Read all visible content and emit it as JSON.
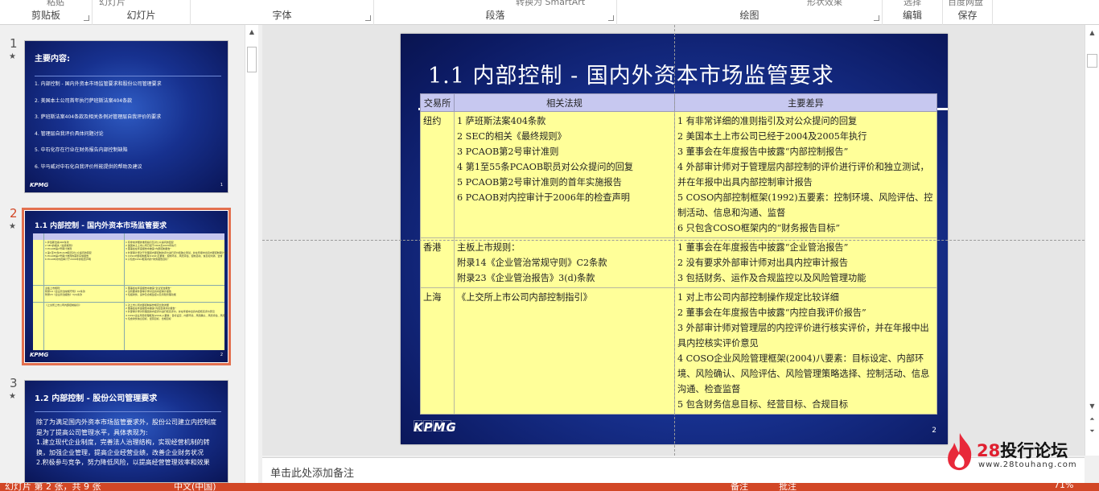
{
  "ribbon": {
    "groups": [
      {
        "label": "剪贴板",
        "cut_text": "粘贴"
      },
      {
        "label": "幻灯片",
        "cut_text": "幻灯片"
      },
      {
        "label": "字体",
        "cut_text": ""
      },
      {
        "label": "段落",
        "cut_text": "转换为 SmartArt"
      },
      {
        "label": "绘图",
        "cut_text": "形状效果"
      },
      {
        "label": "编辑",
        "cut_text": "选择"
      },
      {
        "label": "保存",
        "cut_text": "百度网盘"
      }
    ]
  },
  "thumbnails": [
    {
      "num": "1",
      "title": "主要内容:",
      "items": [
        "1. 内部控制 - 国内外资本市场监管要求和股份公司管理要求",
        "2. 美国本土公司首年执行萨班斯法案404条款",
        "3. 萨班斯法案404条款及相关条例对管理层自我评价的要求",
        "4. 管理层自我评价具体问题讨论",
        "5. 中石化存在行业在财务报告内部控制缺陷",
        "6. 毕马威对中石化自我评价所能提供的帮助及建议"
      ],
      "logo": "KPMG",
      "page": "1"
    },
    {
      "num": "2",
      "title": "1.1 内部控制 - 国内外资本市场监管要求",
      "logo": "KPMG",
      "page": "2"
    },
    {
      "num": "3",
      "title": "1.2 内部控制 - 股份公司管理要求",
      "body": "除了为满足国内外资本市场监管要求外，股份公司建立内控制度是为了提高公司管理水平，具体表现为:\n1.建立现代企业制度，完善法人治理结构，实现经营机制的转换，加强企业管理，提高企业经营业绩，改善企业财务状况\n2.积极参与竞争，努力降低风险，以提高经营管理效率和效果"
    }
  ],
  "slide": {
    "title": "1.1 内部控制 - 国内外资本市场监管要求",
    "headers": [
      "交易所",
      "相关法规",
      "主要差异"
    ],
    "rows": [
      {
        "exchange": "纽约",
        "laws": "1 萨班斯法案404条款\n2 SEC的相关《最终规则》\n3 PCAOB第2号审计准则\n4 第1至55条PCAOB职员对公众提问的回复\n5 PCAOB第2号审计准则的首年实施报告\n6 PCAOB对内控审计于2006年的检查声明",
        "diffs": "1 有非常详细的准则指引及对公众提问的回复\n2 美国本土上市公司已经于2004及2005年执行\n3 董事会在年度报告中披露“内部控制报告”\n4 外部审计师对于管理层内部控制的评价进行评价和独立测试，并在年报中出具内部控制审计报告\n5 COSO内部控制框架(1992)五要素：控制环境、风险评估、控制活动、信息和沟通、监督\n6 只包含COSO框架内的“财务报告目标”"
      },
      {
        "exchange": "香港",
        "laws": "主板上市规则：\n附录14《企业管治常规守则》C2条款\n附录23《企业管治报告》3(d)条款",
        "diffs": "1 董事会在年度报告中披露“企业管治报告”\n2 没有要求外部审计师对出具内控审计报告\n3 包括财务、运作及合规监控以及风险管理功能"
      },
      {
        "exchange": "上海",
        "laws": "《上交所上市公司内部控制指引》",
        "diffs": "1 对上市公司内部控制操作规定比较详细\n2 董事会在年度报告中披露“内控自我评价报告”\n3 外部审计师对管理层的内控评价进行核实评价，并在年报中出具内控核实评价意见\n4 COSO企业风险管理框架(2004)八要素：目标设定、内部环境、风险确认、风险评估、风险管理策略选择、控制活动、信息沟通、检查监督\n5 包含财务信息目标、经营目标、合规目标"
      }
    ],
    "logo": "KPMG",
    "page": "2"
  },
  "notes": {
    "placeholder": "单击此处添加备注"
  },
  "status": {
    "slide_info": "幻灯片 第 2 张，共 9 张",
    "language": "中文(中国)",
    "notes_label": "备注",
    "comments_label": "批注",
    "zoom": "71%"
  },
  "watermark": {
    "brand_num": "28",
    "brand_text": "投行论坛",
    "url": "www.28touhang.com"
  },
  "colors": {
    "accent": "#d24726",
    "table_fill": "#ffff99",
    "table_header": "#c7c8f0",
    "slide_blue": "#1a3699"
  }
}
